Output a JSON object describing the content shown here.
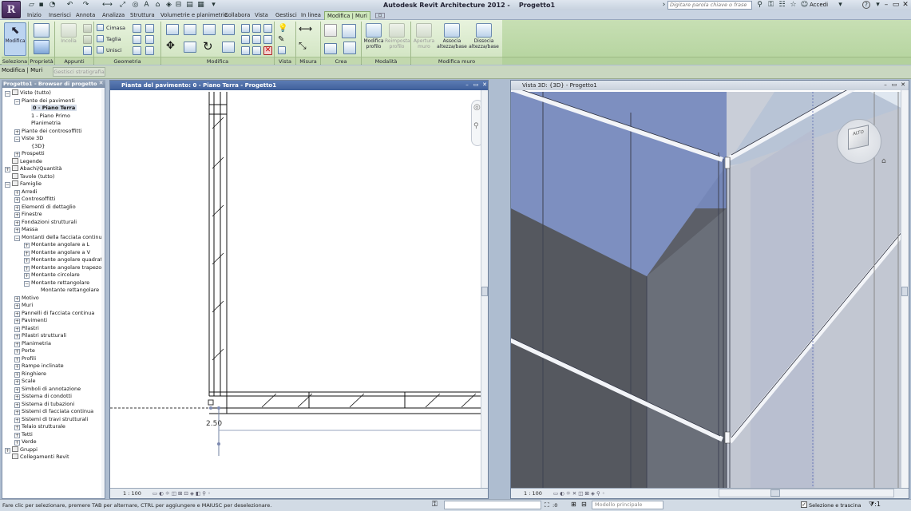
{
  "app": {
    "logo_letter": "R",
    "title": "Autodesk Revit Architecture 2012 -",
    "project_title": "Progetto1",
    "search_placeholder": "Digitare parola chiave o frase",
    "sign_in": "Accedi",
    "help": "?"
  },
  "tabs": [
    "Inizio",
    "Inserisci",
    "Annota",
    "Analizza",
    "Struttura",
    "Volumetrie e planimetria",
    "Collabora",
    "Vista",
    "Gestisci",
    "In linea",
    "Modifica | Muri"
  ],
  "active_tab": "Modifica | Muri",
  "ribbon": {
    "seleziona": {
      "button": "Modifica",
      "label": "Seleziona"
    },
    "proprieta": {
      "label": "Proprietà"
    },
    "appunti": {
      "button": "Incolla",
      "label": "Appunti"
    },
    "geometria": {
      "items": [
        "Cimasa",
        "Taglia",
        "Unisci"
      ],
      "label": "Geometria"
    },
    "modifica": {
      "label": "Modifica"
    },
    "vista": {
      "label": "Vista"
    },
    "misura": {
      "label": "Misura"
    },
    "crea": {
      "label": "Crea"
    },
    "modalita": {
      "buttons": [
        "Modifica profilo",
        "Reimposta profilo"
      ],
      "label": "Modalità"
    },
    "modifica_muro": {
      "buttons": [
        "Apertura muro",
        "Associa altezza/base",
        "Dissocia altezza/base"
      ],
      "label": "Modifica muro"
    }
  },
  "context_bar": {
    "label": "Modifica | Muri",
    "button": "Gestisci stratigrafia"
  },
  "project_browser": {
    "title": "Progetto1 - Browser di progetto",
    "nodes": [
      {
        "t": "Viste (tutto)",
        "lvl": 0,
        "pm": "-",
        "sel": false
      },
      {
        "t": "Piante dei pavimenti",
        "lvl": 1,
        "pm": "-",
        "sel": false
      },
      {
        "t": "0 - Piano Terra",
        "lvl": 2,
        "pm": "",
        "sel": true
      },
      {
        "t": "1 - Piano Primo",
        "lvl": 2,
        "pm": "",
        "sel": false
      },
      {
        "t": "Planimetria",
        "lvl": 2,
        "pm": "",
        "sel": false
      },
      {
        "t": "Piante dei controsoffitti",
        "lvl": 1,
        "pm": "+",
        "sel": false
      },
      {
        "t": "Viste 3D",
        "lvl": 1,
        "pm": "-",
        "sel": false
      },
      {
        "t": "{3D}",
        "lvl": 2,
        "pm": "",
        "sel": false
      },
      {
        "t": "Prospetti",
        "lvl": 1,
        "pm": "+",
        "sel": false
      },
      {
        "t": "Legende",
        "lvl": 0,
        "pm": "",
        "sel": false
      },
      {
        "t": "Abachi/Quantità",
        "lvl": 0,
        "pm": "+",
        "sel": false
      },
      {
        "t": "Tavole (tutto)",
        "lvl": 0,
        "pm": "",
        "sel": false
      },
      {
        "t": "Famiglie",
        "lvl": 0,
        "pm": "-",
        "sel": false
      },
      {
        "t": "Arredi",
        "lvl": 1,
        "pm": "+",
        "sel": false
      },
      {
        "t": "Controsoffitti",
        "lvl": 1,
        "pm": "+",
        "sel": false
      },
      {
        "t": "Elementi di dettaglio",
        "lvl": 1,
        "pm": "+",
        "sel": false
      },
      {
        "t": "Finestre",
        "lvl": 1,
        "pm": "+",
        "sel": false
      },
      {
        "t": "Fondazioni strutturali",
        "lvl": 1,
        "pm": "+",
        "sel": false
      },
      {
        "t": "Massa",
        "lvl": 1,
        "pm": "+",
        "sel": false
      },
      {
        "t": "Montanti della facciata continua",
        "lvl": 1,
        "pm": "-",
        "sel": false
      },
      {
        "t": "Montante angolare a L",
        "lvl": 2,
        "pm": "+",
        "sel": false
      },
      {
        "t": "Montante angolare a V",
        "lvl": 2,
        "pm": "+",
        "sel": false
      },
      {
        "t": "Montante angolare quadrato",
        "lvl": 2,
        "pm": "+",
        "sel": false
      },
      {
        "t": "Montante angolare trapezoidale",
        "lvl": 2,
        "pm": "+",
        "sel": false
      },
      {
        "t": "Montante circolare",
        "lvl": 2,
        "pm": "+",
        "sel": false
      },
      {
        "t": "Montante rettangolare",
        "lvl": 2,
        "pm": "-",
        "sel": false
      },
      {
        "t": "Montante rettangolare",
        "lvl": 3,
        "pm": "",
        "sel": false
      },
      {
        "t": "Motivo",
        "lvl": 1,
        "pm": "+",
        "sel": false
      },
      {
        "t": "Muri",
        "lvl": 1,
        "pm": "+",
        "sel": false
      },
      {
        "t": "Pannelli di facciata continua",
        "lvl": 1,
        "pm": "+",
        "sel": false
      },
      {
        "t": "Pavimenti",
        "lvl": 1,
        "pm": "+",
        "sel": false
      },
      {
        "t": "Pilastri",
        "lvl": 1,
        "pm": "+",
        "sel": false
      },
      {
        "t": "Pilastri strutturali",
        "lvl": 1,
        "pm": "+",
        "sel": false
      },
      {
        "t": "Planimetria",
        "lvl": 1,
        "pm": "+",
        "sel": false
      },
      {
        "t": "Porte",
        "lvl": 1,
        "pm": "+",
        "sel": false
      },
      {
        "t": "Profili",
        "lvl": 1,
        "pm": "+",
        "sel": false
      },
      {
        "t": "Rampe inclinate",
        "lvl": 1,
        "pm": "+",
        "sel": false
      },
      {
        "t": "Ringhiere",
        "lvl": 1,
        "pm": "+",
        "sel": false
      },
      {
        "t": "Scale",
        "lvl": 1,
        "pm": "+",
        "sel": false
      },
      {
        "t": "Simboli di annotazione",
        "lvl": 1,
        "pm": "+",
        "sel": false
      },
      {
        "t": "Sistema di condotti",
        "lvl": 1,
        "pm": "+",
        "sel": false
      },
      {
        "t": "Sistema di tubazioni",
        "lvl": 1,
        "pm": "+",
        "sel": false
      },
      {
        "t": "Sistemi di facciata continua",
        "lvl": 1,
        "pm": "+",
        "sel": false
      },
      {
        "t": "Sistemi di travi strutturali",
        "lvl": 1,
        "pm": "+",
        "sel": false
      },
      {
        "t": "Telaio strutturale",
        "lvl": 1,
        "pm": "+",
        "sel": false
      },
      {
        "t": "Tetti",
        "lvl": 1,
        "pm": "+",
        "sel": false
      },
      {
        "t": "Verde",
        "lvl": 1,
        "pm": "+",
        "sel": false
      },
      {
        "t": "Gruppi",
        "lvl": 0,
        "pm": "+",
        "sel": false
      },
      {
        "t": "Collegamenti Revit",
        "lvl": 0,
        "pm": "",
        "sel": false
      }
    ]
  },
  "views": {
    "plan": {
      "title": "Pianta del pavimento: 0 - Piano Terra - Progetto1",
      "scale": "1 : 100",
      "dimension": "2.50"
    },
    "view3d": {
      "title": "Vista 3D: {3D} - Progetto1",
      "scale": "1 : 100",
      "viewcube": "ALTO"
    }
  },
  "status": {
    "hint": "Fare clic per selezionare, premere TAB per alternare, CTRL per aggiungere e MAIUSC per deselezionare.",
    "coord": ":0",
    "model": "Modello principale",
    "select_drag": "Selezione e trascina",
    "filter": "⧩:1"
  },
  "colors": {
    "ribbon_green": "#cfe3bf",
    "active_view_title": "#4a6aa6",
    "glass": "#7b8fbf",
    "wall_dark": "#5e6068"
  }
}
